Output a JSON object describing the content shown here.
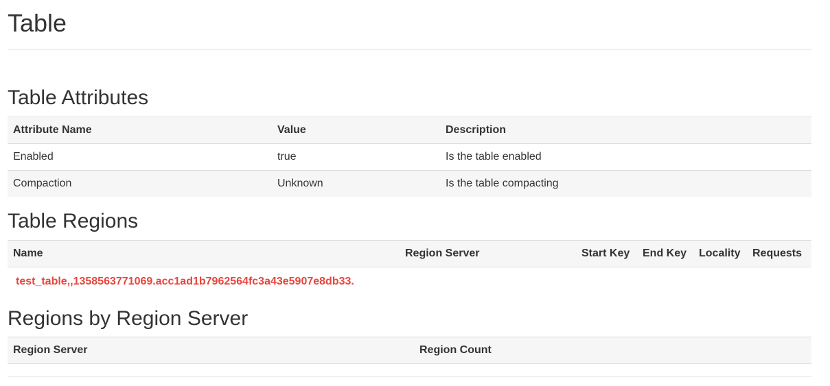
{
  "page_title": "Table",
  "attributes": {
    "heading": "Table Attributes",
    "columns": [
      "Attribute Name",
      "Value",
      "Description"
    ],
    "rows": [
      [
        "Enabled",
        "true",
        "Is the table enabled"
      ],
      [
        "Compaction",
        "Unknown",
        "Is the table compacting"
      ]
    ]
  },
  "regions": {
    "heading": "Table Regions",
    "columns": [
      "Name",
      "Region Server",
      "Start Key",
      "End Key",
      "Locality",
      "Requests"
    ],
    "rows": [
      {
        "name": "test_table,,1358563771069.acc1ad1b7962564fc3a43e5907e8db33.",
        "region_server": "",
        "start_key": "",
        "end_key": "",
        "locality": "",
        "requests": ""
      }
    ],
    "link_color": "#e8453c"
  },
  "by_server": {
    "heading": "Regions by Region Server",
    "columns": [
      "Region Server",
      "Region Count"
    ]
  }
}
